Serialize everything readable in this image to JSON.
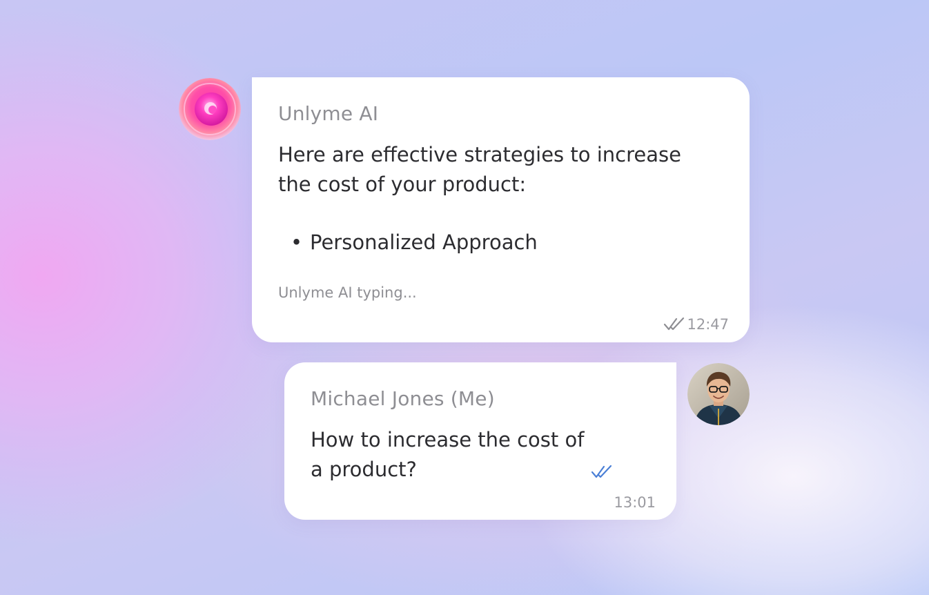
{
  "ai_message": {
    "sender": "Unlyme AI",
    "text": "Here are effective strategies to increase the cost of your product:",
    "bullets": [
      "Personalized Approach"
    ],
    "bullet_symbol": "•",
    "typing_status": "Unlyme AI typing...",
    "time": "12:47",
    "read_icon": "double-check-icon",
    "read_icon_color": "#8e8e93",
    "avatar_icon": "ai-orb-icon"
  },
  "user_message": {
    "sender": "Michael Jones (Me)",
    "text": "How to increase the cost of a product?",
    "time": "13:01",
    "read_icon": "double-check-icon",
    "read_icon_color": "#4a7fd6",
    "avatar_icon": "user-photo-avatar"
  },
  "colors": {
    "bubble": "#ffffff",
    "text": "#2c2c30",
    "muted": "#8e8e93",
    "accent_check": "#4a7fd6",
    "ai_orb": "#ff3fb6"
  }
}
